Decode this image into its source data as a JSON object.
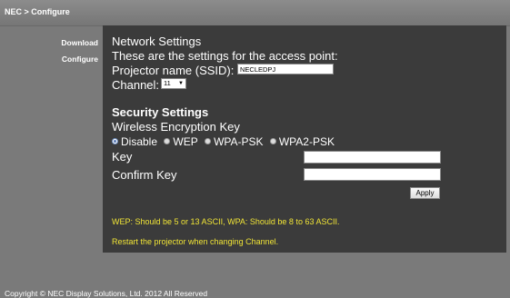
{
  "header": {
    "breadcrumb": "NEC > Configure"
  },
  "sidebar": {
    "items": [
      {
        "label": "Download"
      },
      {
        "label": "Configure"
      }
    ]
  },
  "network": {
    "title": "Network Settings",
    "description": "These are the settings for the access point:",
    "ssid_label": "Projector name (SSID):",
    "ssid_value": "NECLEDPJ",
    "channel_label": "Channel:",
    "channel_value": "11"
  },
  "security": {
    "title": "Security Settings",
    "subtitle": "Wireless Encryption Key",
    "options": [
      {
        "label": "Disable",
        "selected": true
      },
      {
        "label": "WEP",
        "selected": false
      },
      {
        "label": "WPA-PSK",
        "selected": false
      },
      {
        "label": "WPA2-PSK",
        "selected": false
      }
    ],
    "key_label": "Key",
    "confirm_key_label": "Confirm Key",
    "key_value": "",
    "confirm_key_value": "",
    "apply_label": "Apply"
  },
  "notes": {
    "key_length": "WEP: Should be 5 or 13 ASCII, WPA: Should be 8 to 63 ASCII.",
    "restart": "Restart the projector when changing Channel."
  },
  "footer": {
    "copyright": "Copyright © NEC Display Solutions, Ltd. 2012 All Reserved"
  },
  "colors": {
    "panel_bg": "#3b3b3b",
    "page_bg": "#7a7a7a",
    "note_text": "#f0e436"
  }
}
